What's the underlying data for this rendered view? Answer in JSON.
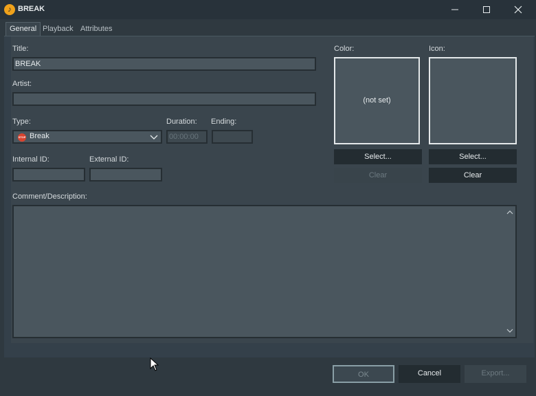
{
  "window": {
    "title": "BREAK",
    "logo_icon": "app-logo-icon",
    "controls": [
      "minimize-icon",
      "maximize-icon",
      "close-icon"
    ]
  },
  "tabs": [
    {
      "label": "General",
      "active": true
    },
    {
      "label": "Playback",
      "active": false
    },
    {
      "label": "Attributes",
      "active": false
    }
  ],
  "general": {
    "title_label": "Title:",
    "title_value": "BREAK",
    "artist_label": "Artist:",
    "artist_value": "",
    "type_label": "Type:",
    "type_value": "Break",
    "type_icon": "stop-icon",
    "stop_icon_text": "STOP",
    "duration_label": "Duration:",
    "duration_placeholder": "00:00:00",
    "ending_label": "Ending:",
    "ending_value": "",
    "internal_id_label": "Internal ID:",
    "internal_id_value": "",
    "external_id_label": "External ID:",
    "external_id_value": "",
    "comment_label": "Comment/Description:",
    "comment_value": ""
  },
  "color": {
    "label": "Color:",
    "swatch_text": "(not set)",
    "select_label": "Select...",
    "clear_label": "Clear",
    "clear_enabled": false
  },
  "icon": {
    "label": "Icon:",
    "select_label": "Select...",
    "clear_label": "Clear",
    "clear_enabled": true
  },
  "footer": {
    "ok_label": "OK",
    "cancel_label": "Cancel",
    "export_label": "Export...",
    "ok_enabled": false,
    "export_enabled": false
  },
  "colors": {
    "background": "#2f3940",
    "panel": "#3a454d",
    "field": "#4a565e",
    "button": "#232c31",
    "accent_logo": "#f0a21b",
    "stop_red": "#d9442f"
  }
}
